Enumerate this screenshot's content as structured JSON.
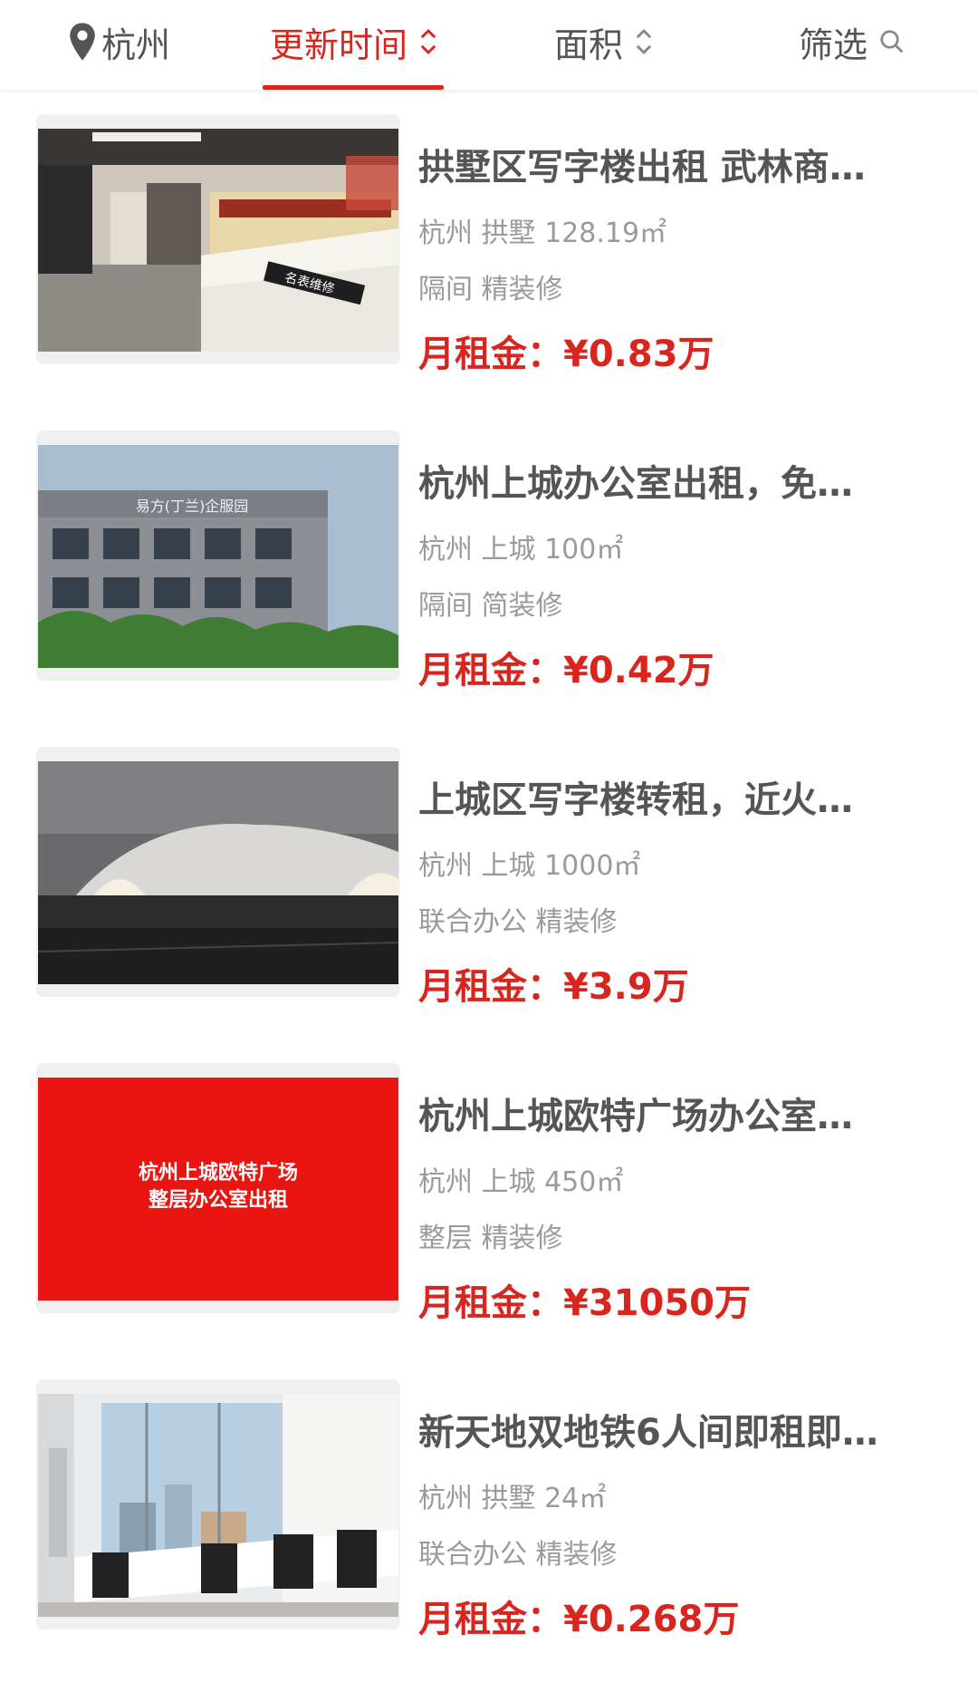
{
  "header": {
    "city": "杭州",
    "tab_time": "更新时间",
    "tab_area": "面积",
    "tab_filter": "筛选"
  },
  "listings": [
    {
      "title": "拱墅区写字楼出租 武林商…",
      "location": "杭州 拱墅 128.19㎡",
      "tags": "隔间 精装修",
      "price_label": "月租金：",
      "price_value": "¥0.83万",
      "image_text": "名表维修"
    },
    {
      "title": "杭州上城办公室出租，免…",
      "location": "杭州 上城 100㎡",
      "tags": "隔间 简装修",
      "price_label": "月租金：",
      "price_value": "¥0.42万",
      "image_text": "易方(丁兰)企服园"
    },
    {
      "title": "上城区写字楼转租，近火…",
      "location": "杭州 上城 1000㎡",
      "tags": "联合办公 精装修",
      "price_label": "月租金：",
      "price_value": "¥3.9万"
    },
    {
      "title": "杭州上城欧特广场办公室…",
      "location": "杭州 上城 450㎡",
      "tags": "整层 精装修",
      "price_label": "月租金：",
      "price_value": "¥31050万",
      "image_text_1": "杭州上城欧特广场",
      "image_text_2": "整层办公室出租"
    },
    {
      "title": "新天地双地铁6人间即租即…",
      "location": "杭州 拱墅 24㎡",
      "tags": "联合办公 精装修",
      "price_label": "月租金：",
      "price_value": "¥0.268万"
    }
  ],
  "colors": {
    "accent": "#d8261f",
    "text_primary": "#555555",
    "text_secondary": "#9a9a9a"
  },
  "icons": [
    "location-pin-icon",
    "sort-icon",
    "search-icon"
  ]
}
